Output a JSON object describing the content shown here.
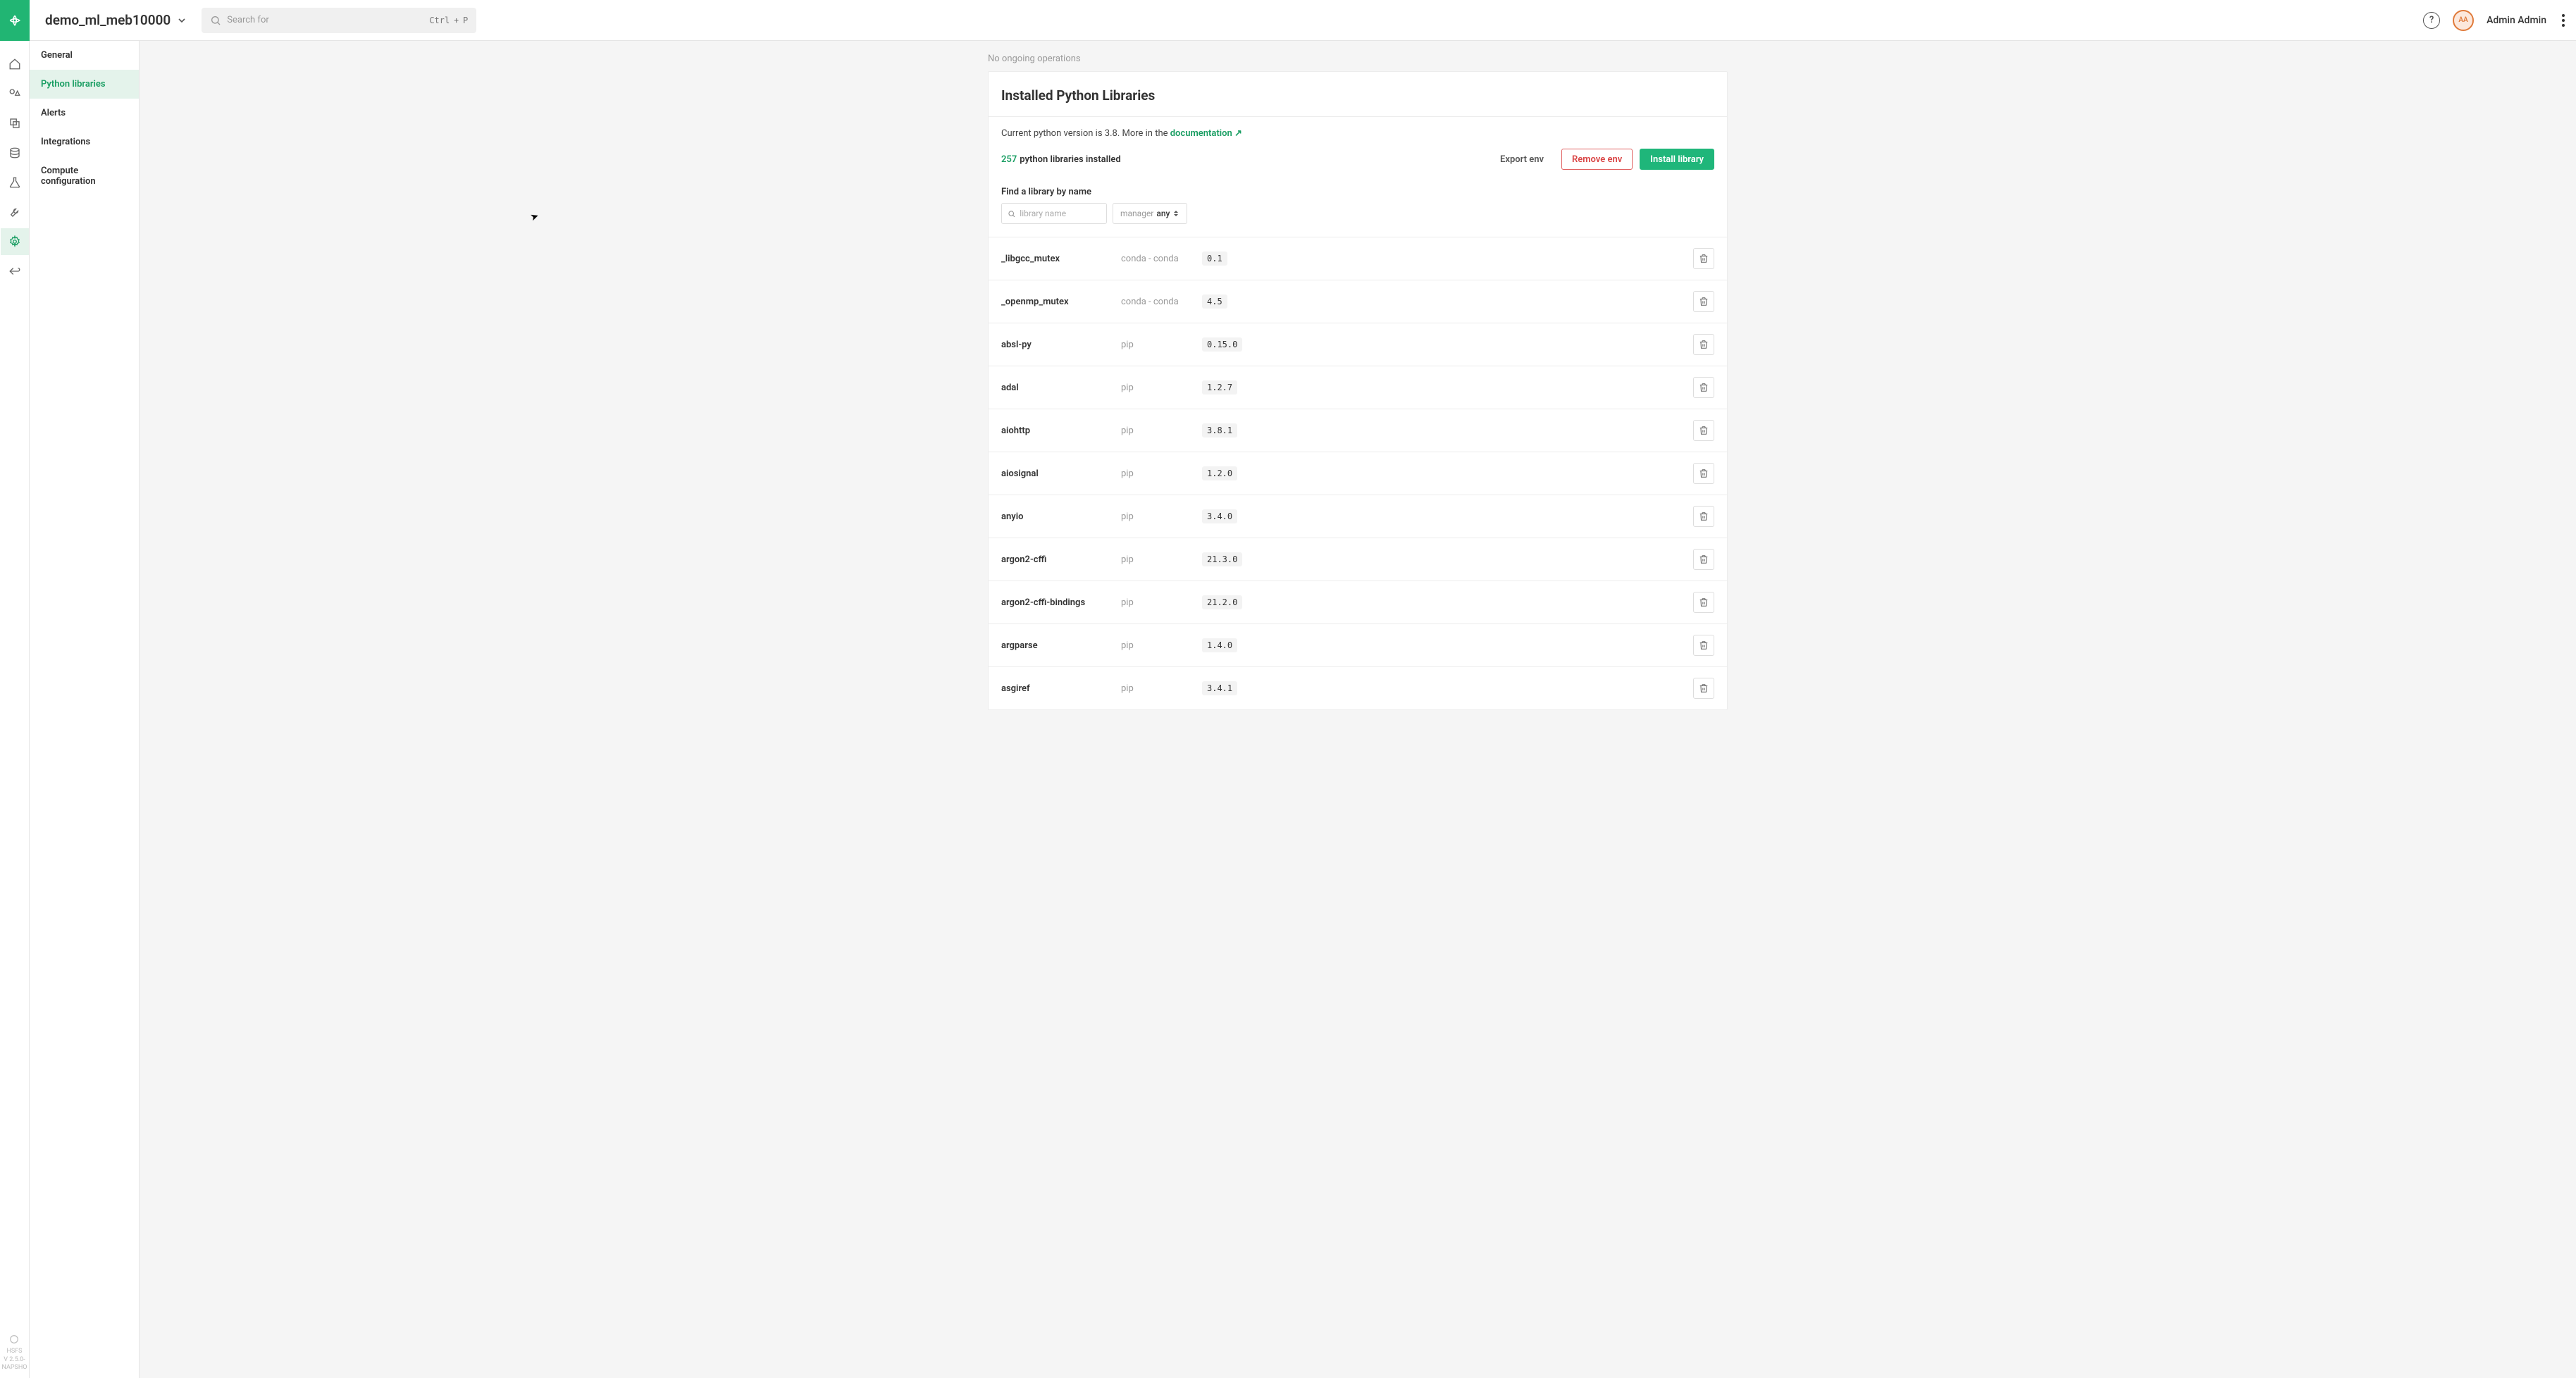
{
  "header": {
    "project_name": "demo_ml_meb10000",
    "search_placeholder": "Search for",
    "kbd_ctrl": "Ctrl",
    "kbd_plus": "+",
    "kbd_key": "P",
    "avatar_initials": "AA",
    "user_name": "Admin Admin"
  },
  "rail_footer": {
    "line1": "HSFS",
    "line2": "V 2.5.0-",
    "line3": "NAPSHO"
  },
  "sidebar": {
    "items": [
      {
        "label": "General"
      },
      {
        "label": "Python libraries"
      },
      {
        "label": "Alerts"
      },
      {
        "label": "Integrations"
      },
      {
        "label": "Compute configuration"
      }
    ]
  },
  "ops_status": "No ongoing operations",
  "card": {
    "title": "Installed Python Libraries",
    "info_prefix": "Current python version is 3.8. More in the ",
    "doc_link": "documentation ↗",
    "count": "257",
    "count_label": "python libraries installed",
    "btn_export": "Export env",
    "btn_remove": "Remove env",
    "btn_install": "Install library",
    "filter_label": "Find a library by name",
    "name_placeholder": "library name",
    "manager_label": "manager",
    "manager_value": "any"
  },
  "libraries": [
    {
      "name": "_libgcc_mutex",
      "manager": "conda - conda",
      "version": "0.1"
    },
    {
      "name": "_openmp_mutex",
      "manager": "conda - conda",
      "version": "4.5"
    },
    {
      "name": "absl-py",
      "manager": "pip",
      "version": "0.15.0"
    },
    {
      "name": "adal",
      "manager": "pip",
      "version": "1.2.7"
    },
    {
      "name": "aiohttp",
      "manager": "pip",
      "version": "3.8.1"
    },
    {
      "name": "aiosignal",
      "manager": "pip",
      "version": "1.2.0"
    },
    {
      "name": "anyio",
      "manager": "pip",
      "version": "3.4.0"
    },
    {
      "name": "argon2-cffi",
      "manager": "pip",
      "version": "21.3.0"
    },
    {
      "name": "argon2-cffi-bindings",
      "manager": "pip",
      "version": "21.2.0"
    },
    {
      "name": "argparse",
      "manager": "pip",
      "version": "1.4.0"
    },
    {
      "name": "asgiref",
      "manager": "pip",
      "version": "3.4.1"
    }
  ]
}
